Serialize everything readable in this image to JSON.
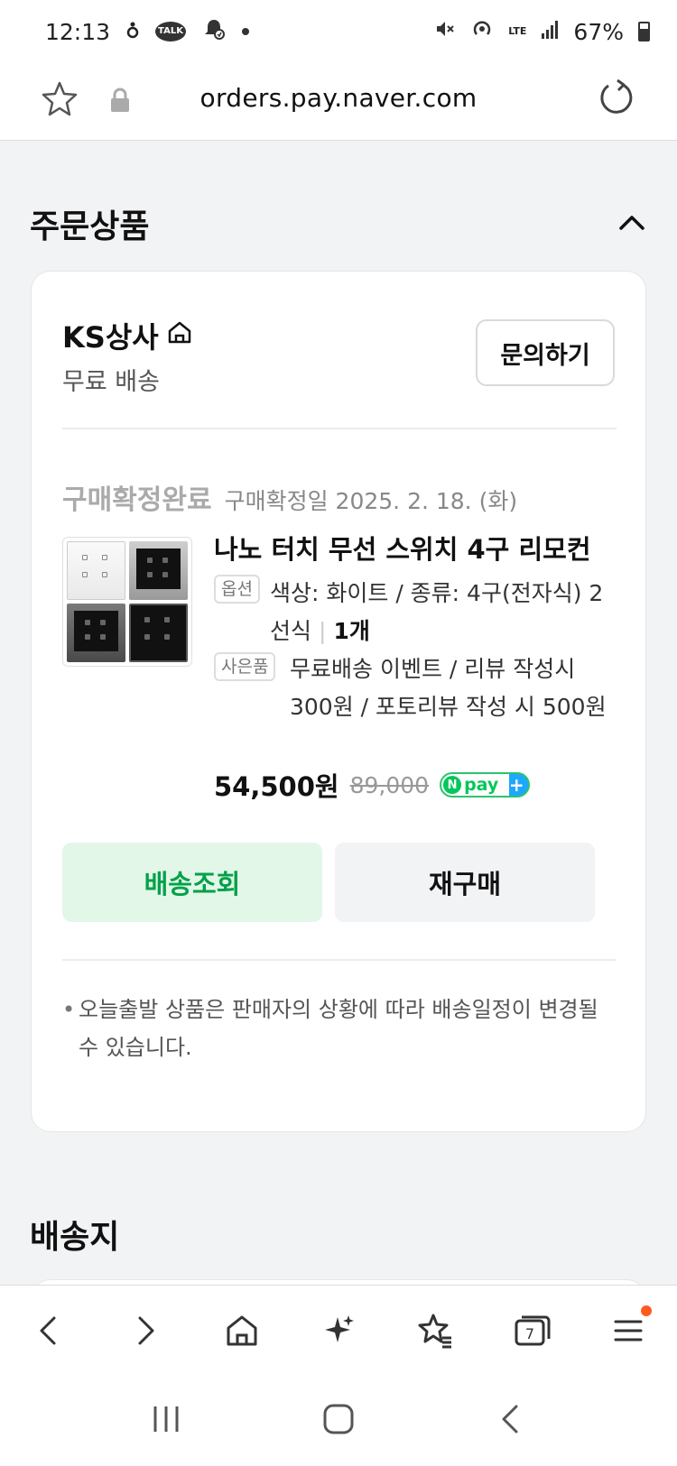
{
  "status_bar": {
    "time": "12:13",
    "talk_badge": "TALK",
    "lte": "LTE",
    "battery": "67%"
  },
  "browser": {
    "url": "orders.pay.naver.com"
  },
  "order_section": {
    "title": "주문상품",
    "store": {
      "name": "KS상사",
      "shipping": "무료 배송",
      "inquiry_label": "문의하기"
    },
    "status": {
      "label": "구매확정완료",
      "date": "구매확정일 2025. 2. 18. (화)"
    },
    "product": {
      "title": "나노 터치 무선 스위치 4구 리모컨",
      "option_tag": "옵션",
      "option_text": "색상: 화이트 / 종류: 4구(전자식) 2선식",
      "quantity": "1개",
      "gift_tag": "사은품",
      "gift_text": "무료배송 이벤트 / 리뷰 작성시 300원 / 포토리뷰 작성 시 500원",
      "price": "54,500원",
      "original_price": "89,000",
      "npay_n": "N",
      "npay_label": "pay",
      "npay_plus": "+"
    },
    "buttons": {
      "track": "배송조회",
      "rebuy": "재구매"
    },
    "notice": "오늘출발 상품은 판매자의 상황에 따라 배송일정이 변경될 수 있습니다."
  },
  "delivery_section": {
    "title": "배송지"
  },
  "toolbar": {
    "tabs_count": "7"
  },
  "colors": {
    "accent_green": "#03c75a",
    "track_bg": "#e3f7e8",
    "notif_dot": "#ff5a1f"
  },
  "icons": [
    "star-icon",
    "lock-icon",
    "reload-icon",
    "chevron-up-icon",
    "home-icon",
    "back-icon",
    "forward-icon",
    "sparkle-icon",
    "bookmarks-icon",
    "tabs-icon",
    "menu-icon"
  ]
}
